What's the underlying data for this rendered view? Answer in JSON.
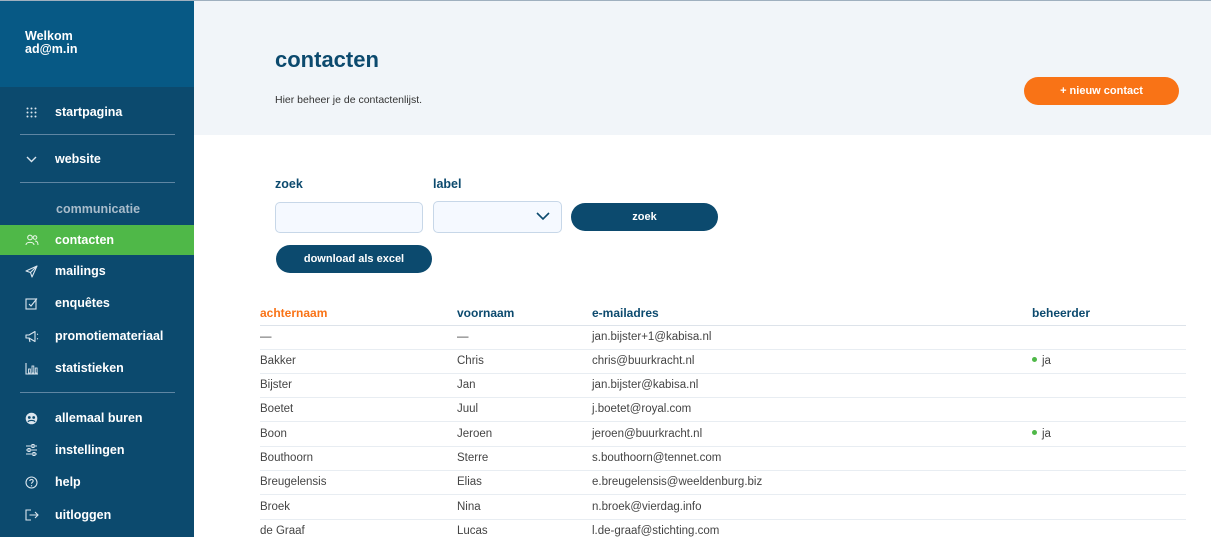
{
  "sidebar": {
    "welcome": "Welkom",
    "user": "ad@m.in",
    "items": [
      {
        "label": "startpagina",
        "icon": "grid-dots-icon"
      },
      {
        "label": "website",
        "icon": "chevron-down-icon"
      },
      {
        "label": "contacten",
        "icon": "users-icon"
      },
      {
        "label": "mailings",
        "icon": "paper-plane-icon"
      },
      {
        "label": "enquêtes",
        "icon": "checkbox-edit-icon"
      },
      {
        "label": "promotiemateriaal",
        "icon": "megaphone-icon"
      },
      {
        "label": "statistieken",
        "icon": "bar-chart-icon"
      },
      {
        "label": "allemaal buren",
        "icon": "neighbours-icon"
      },
      {
        "label": "instellingen",
        "icon": "sliders-icon"
      },
      {
        "label": "help",
        "icon": "question-circle-icon"
      },
      {
        "label": "uitloggen",
        "icon": "logout-icon"
      }
    ],
    "section_communicatie": "communicatie",
    "colors": {
      "background": "#0c4a6e",
      "active": "#4fb848"
    }
  },
  "header": {
    "title": "contacten",
    "subtitle": "Hier beheer je de contactenlijst.",
    "new_button": "+ nieuw contact",
    "accent": "#f97316"
  },
  "filters": {
    "search_label": "zoek",
    "label_label": "label",
    "search_value": "",
    "label_value": "",
    "search_button": "zoek",
    "download_button": "download als excel"
  },
  "table": {
    "columns": [
      "achternaam",
      "voornaam",
      "e-mailadres",
      "beheerder"
    ],
    "sorted_column": "achternaam",
    "rows": [
      {
        "achternaam": "—",
        "voornaam": "—",
        "email": "jan.bijster+1@kabisa.nl",
        "beheerder": ""
      },
      {
        "achternaam": "Bakker",
        "voornaam": "Chris",
        "email": "chris@buurkracht.nl",
        "beheerder": "ja"
      },
      {
        "achternaam": "Bijster",
        "voornaam": "Jan",
        "email": "jan.bijster@kabisa.nl",
        "beheerder": ""
      },
      {
        "achternaam": "Boetet",
        "voornaam": "Juul",
        "email": "j.boetet@royal.com",
        "beheerder": ""
      },
      {
        "achternaam": "Boon",
        "voornaam": "Jeroen",
        "email": "jeroen@buurkracht.nl",
        "beheerder": "ja"
      },
      {
        "achternaam": "Bouthoorn",
        "voornaam": "Sterre",
        "email": "s.bouthoorn@tennet.com",
        "beheerder": ""
      },
      {
        "achternaam": "Breugelensis",
        "voornaam": "Elias",
        "email": "e.breugelensis@weeldenburg.biz",
        "beheerder": ""
      },
      {
        "achternaam": "Broek",
        "voornaam": "Nina",
        "email": "n.broek@vierdag.info",
        "beheerder": ""
      },
      {
        "achternaam": "de Graaf",
        "voornaam": "Lucas",
        "email": "l.de-graaf@stichting.com",
        "beheerder": ""
      }
    ]
  }
}
